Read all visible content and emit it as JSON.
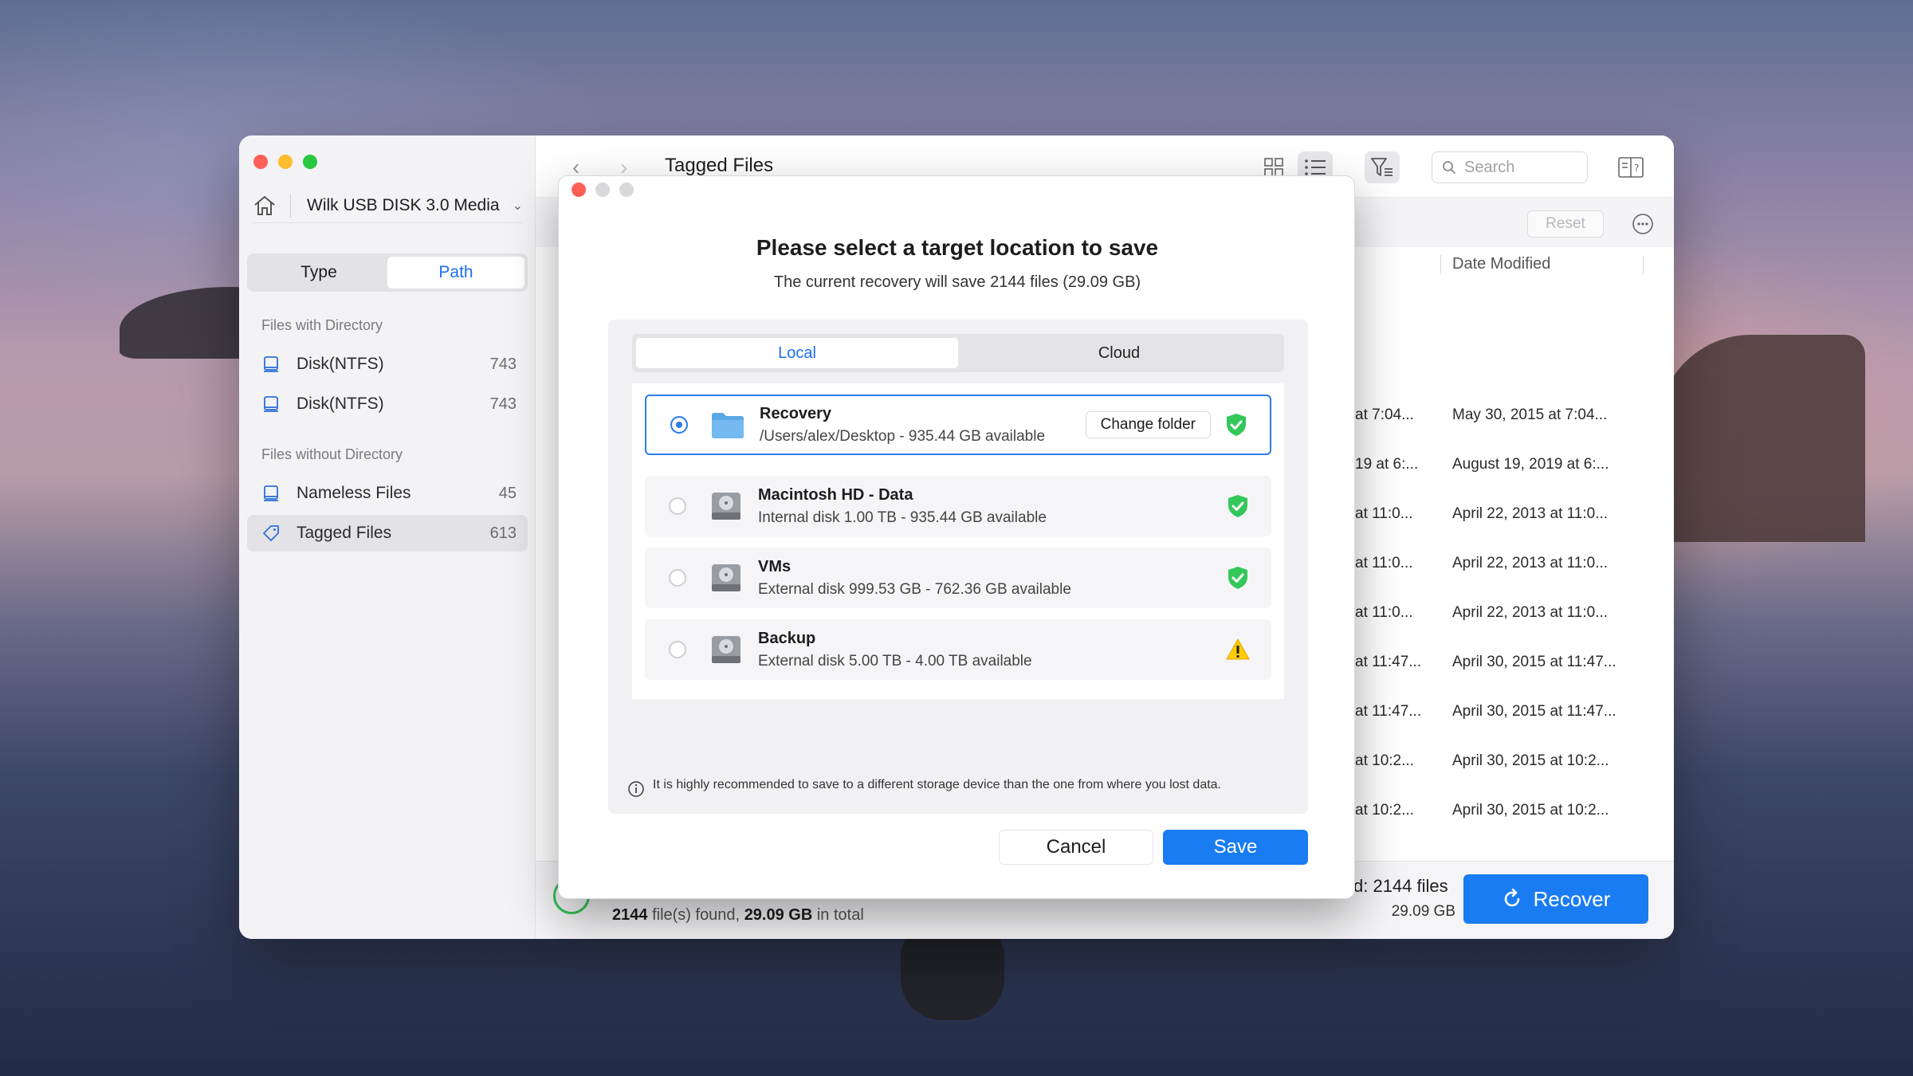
{
  "sidebar": {
    "device_name": "Wilk USB DISK 3.0 Media",
    "segment": {
      "type_label": "Type",
      "path_label": "Path",
      "active": "Path"
    },
    "group_with_dir": "Files with Directory",
    "group_without_dir": "Files without Directory",
    "items": [
      {
        "label": "Disk(NTFS)",
        "count": "743"
      },
      {
        "label": "Disk(NTFS)",
        "count": "743"
      },
      {
        "label": "Nameless Files",
        "count": "45"
      },
      {
        "label": "Tagged Files",
        "count": "613"
      }
    ]
  },
  "toolbar": {
    "title": "Tagged Files",
    "search_placeholder": "Search",
    "reset_label": "Reset"
  },
  "table": {
    "date_modified_header": "Date Modified",
    "rows": [
      {
        "a": "at 7:04...",
        "b": "May 30, 2015 at 7:04..."
      },
      {
        "a": "19 at 6:...",
        "b": "August 19, 2019 at 6:..."
      },
      {
        "a": "at 11:0...",
        "b": "April 22, 2013 at 11:0..."
      },
      {
        "a": "at 11:0...",
        "b": "April 22, 2013 at 11:0..."
      },
      {
        "a": "at 11:0...",
        "b": "April 22, 2013 at 11:0..."
      },
      {
        "a": "at 11:47...",
        "b": "April 30, 2015 at 11:47..."
      },
      {
        "a": "at 11:47...",
        "b": "April 30, 2015 at 11:47..."
      },
      {
        "a": "at 10:2...",
        "b": "April 30, 2015 at 10:2..."
      },
      {
        "a": "at 10:2...",
        "b": "April 30, 2015 at 10:2..."
      }
    ]
  },
  "status": {
    "files_count": "2144",
    "files_suffix": "file(s) found,",
    "total_size": "29.09 GB",
    "total_suffix": "in total",
    "found_label": "d: 2144 files",
    "found_size": "29.09 GB",
    "recover_label": "Recover"
  },
  "modal": {
    "title": "Please select a target location to save",
    "subtitle": "The current recovery will save 2144 files (29.09 GB)",
    "tabs": {
      "local": "Local",
      "cloud": "Cloud",
      "active": "Local"
    },
    "locations": [
      {
        "name": "Recovery",
        "desc": "/Users/alex/Desktop - 935.44 GB available",
        "selected": true,
        "status": "ok",
        "change_folder": "Change folder"
      },
      {
        "name": "Macintosh HD - Data",
        "desc": "Internal disk 1.00 TB - 935.44 GB available",
        "selected": false,
        "status": "ok"
      },
      {
        "name": "VMs",
        "desc": "External disk 999.53 GB - 762.36 GB available",
        "selected": false,
        "status": "ok"
      },
      {
        "name": "Backup",
        "desc": "External disk 5.00 TB - 4.00 TB available",
        "selected": false,
        "status": "warning"
      }
    ],
    "note": "It is highly recommended to save to a different storage device than the one from where you lost data.",
    "cancel_label": "Cancel",
    "save_label": "Save"
  },
  "colors": {
    "accent": "#1a7cf2",
    "ok_badge": "#34c759",
    "warning_badge": "#ffcc00"
  }
}
